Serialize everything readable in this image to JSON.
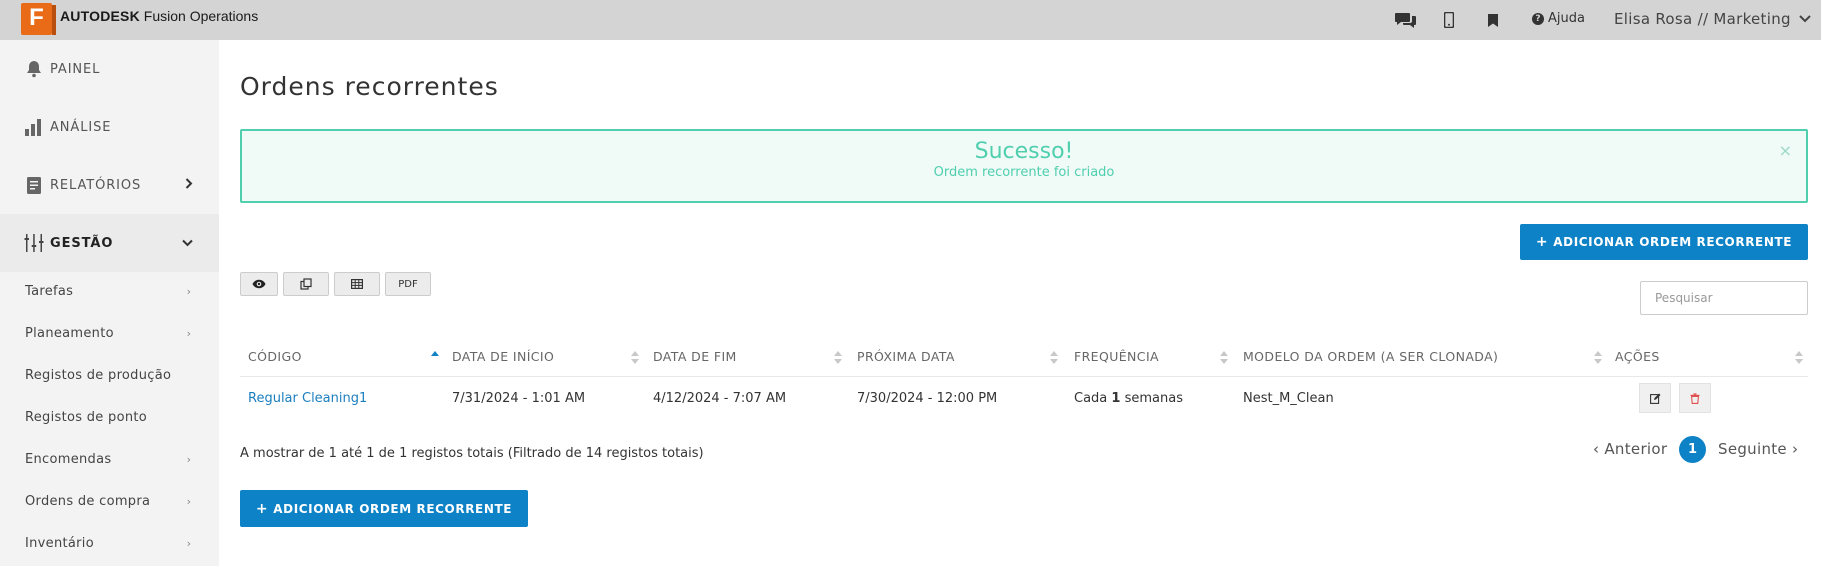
{
  "header": {
    "brand_bold": "AUTODESK",
    "brand_rest": "Fusion Operations",
    "logo_letter": "F",
    "help_label": "Ajuda",
    "user_label": "Elisa Rosa // Marketing",
    "icons": [
      "chat-icon",
      "mobile-icon",
      "bookmark-icon",
      "help-icon",
      "chevron-down-icon"
    ]
  },
  "sidebar": {
    "main_items": [
      {
        "label": "PAINEL",
        "icon": "bell-icon"
      },
      {
        "label": "ANÁLISE",
        "icon": "bar-chart-icon"
      },
      {
        "label": "RELATÓRIOS",
        "icon": "document-icon"
      },
      {
        "label": "GESTÃO",
        "icon": "sliders-icon"
      }
    ],
    "sub_items": [
      {
        "label": "Tarefas",
        "has_chevron": true
      },
      {
        "label": "Planeamento",
        "has_chevron": true
      },
      {
        "label": "Registos de produção",
        "has_chevron": false
      },
      {
        "label": "Registos de ponto",
        "has_chevron": false
      },
      {
        "label": "Encomendas",
        "has_chevron": true
      },
      {
        "label": "Ordens de compra",
        "has_chevron": true
      },
      {
        "label": "Inventário",
        "has_chevron": true
      }
    ]
  },
  "page": {
    "title": "Ordens recorrentes"
  },
  "alert": {
    "title": "Sucesso!",
    "message": "Ordem recorrente foi criado",
    "close": "×"
  },
  "actions": {
    "add_label": "ADICIONAR ORDEM RECORRENTE",
    "add_icon": "+",
    "toolbar": [
      {
        "name": "view-toggle-button",
        "icon": "eye-icon"
      },
      {
        "name": "copy-button",
        "icon": "copy-icon"
      },
      {
        "name": "export-excel-button",
        "icon": "table-icon"
      },
      {
        "name": "export-pdf-button",
        "label": "PDF"
      }
    ],
    "search_placeholder": "Pesquisar"
  },
  "table": {
    "columns": [
      "CÓDIGO",
      "DATA DE INÍCIO",
      "DATA DE FIM",
      "PRÓXIMA DATA",
      "FREQUÊNCIA",
      "MODELO DA ORDEM (A SER CLONADA)",
      "AÇÕES"
    ],
    "sorted_column": "CÓDIGO",
    "rows": [
      {
        "code": "Regular Cleaning1",
        "start": "7/31/2024 - 1:01 AM",
        "end": "4/12/2024 - 7:07 AM",
        "next": "7/30/2024 - 12:00 PM",
        "freq_prefix": "Cada",
        "freq_num": "1",
        "freq_suffix": "semanas",
        "template": "Nest_M_Clean"
      }
    ]
  },
  "footer": {
    "info": "A mostrar de 1 até 1 de 1 registos totais (Filtrado de 14 registos totais)",
    "prev": "Anterior",
    "page": "1",
    "next": "Seguinte"
  },
  "colors": {
    "primary": "#0e82c6",
    "success": "#4fcfae",
    "logo": "#e96b17"
  }
}
